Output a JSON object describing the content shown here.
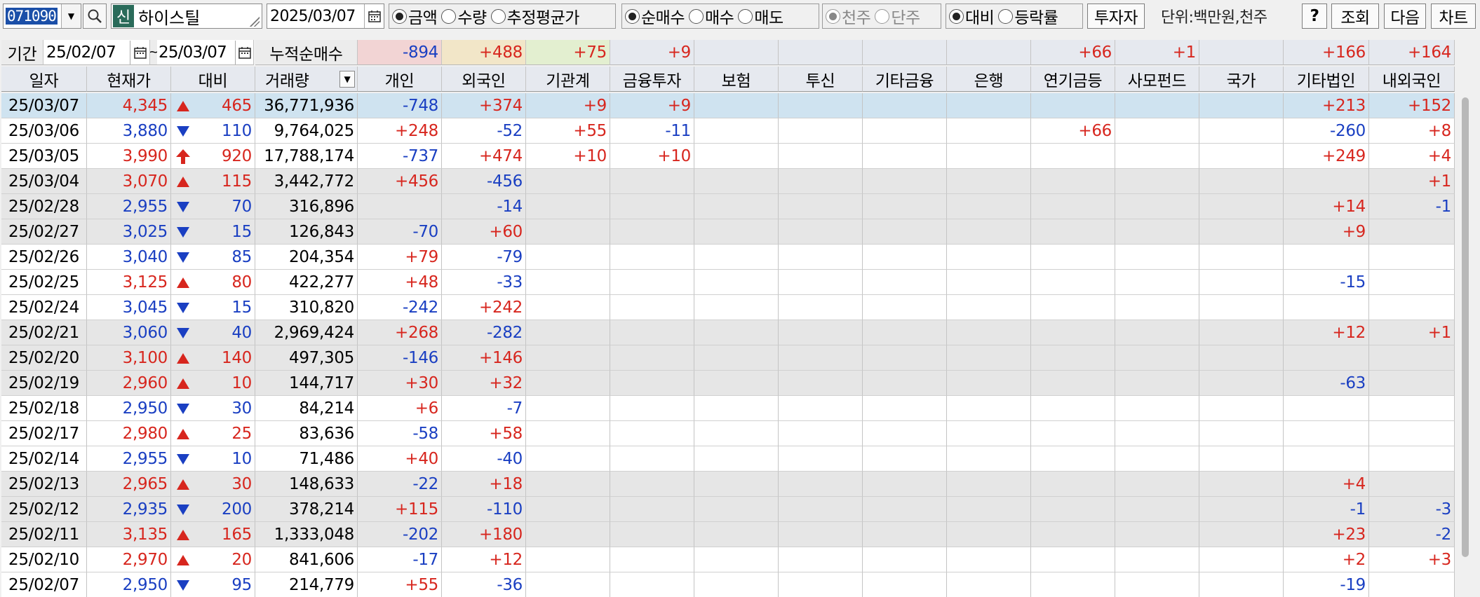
{
  "toolbar": {
    "code": "071090",
    "shin_badge": "신",
    "stock_name": "하이스틸",
    "date": "2025/03/07",
    "radio_amount": [
      {
        "label": "금액",
        "selected": true
      },
      {
        "label": "수량",
        "selected": false
      },
      {
        "label": "추정평균가",
        "selected": false
      }
    ],
    "radio_trade": [
      {
        "label": "순매수",
        "selected": true
      },
      {
        "label": "매수",
        "selected": false
      },
      {
        "label": "매도",
        "selected": false
      }
    ],
    "radio_share": [
      {
        "label": "천주",
        "selected": true
      },
      {
        "label": "단주",
        "selected": false
      }
    ],
    "radio_rate": [
      {
        "label": "대비",
        "selected": true
      },
      {
        "label": "등락률",
        "selected": false
      }
    ],
    "investor_button": "투자자",
    "unit_label": "단위:백만원,천주",
    "help_button": "?",
    "query_button": "조회",
    "next_button": "다음",
    "chart_button": "차트"
  },
  "period": {
    "label": "기간",
    "from": "25/02/07",
    "tilde": "~",
    "to": "25/03/07",
    "cumulative_label": "누적순매수"
  },
  "summary": [
    "-894",
    "+488",
    "+75",
    "+9",
    "",
    "",
    "",
    "",
    "+66",
    "+1",
    "",
    "+166",
    "+164"
  ],
  "headers": [
    "일자",
    "현재가",
    "대비",
    "거래량",
    "개인",
    "외국인",
    "기관계",
    "금융투자",
    "보험",
    "투신",
    "기타금융",
    "은행",
    "연기금등",
    "사모펀드",
    "국가",
    "기타법인",
    "내외국인"
  ],
  "rows": [
    {
      "date": "25/03/07",
      "price": "4,345",
      "dir": "up",
      "chg": "465",
      "vol": "36,771,936",
      "inv": [
        "-748",
        "+374",
        "+9",
        "+9",
        "",
        "",
        "",
        "",
        "",
        "",
        "",
        "+213",
        "+152"
      ]
    },
    {
      "date": "25/03/06",
      "price": "3,880",
      "dir": "down",
      "chg": "110",
      "vol": "9,764,025",
      "inv": [
        "+248",
        "-52",
        "+55",
        "-11",
        "",
        "",
        "",
        "",
        "+66",
        "",
        "",
        "-260",
        "+8"
      ]
    },
    {
      "date": "25/03/05",
      "price": "3,990",
      "dir": "upper",
      "chg": "920",
      "vol": "17,788,174",
      "inv": [
        "-737",
        "+474",
        "+10",
        "+10",
        "",
        "",
        "",
        "",
        "",
        "",
        "",
        "+249",
        "+4"
      ]
    },
    {
      "date": "25/03/04",
      "price": "3,070",
      "dir": "up",
      "chg": "115",
      "vol": "3,442,772",
      "inv": [
        "+456",
        "-456",
        "",
        "",
        "",
        "",
        "",
        "",
        "",
        "",
        "",
        "",
        "+1"
      ]
    },
    {
      "date": "25/02/28",
      "price": "2,955",
      "dir": "down",
      "chg": "70",
      "vol": "316,896",
      "inv": [
        "",
        "-14",
        "",
        "",
        "",
        "",
        "",
        "",
        "",
        "",
        "",
        "+14",
        "-1"
      ]
    },
    {
      "date": "25/02/27",
      "price": "3,025",
      "dir": "down",
      "chg": "15",
      "vol": "126,843",
      "inv": [
        "-70",
        "+60",
        "",
        "",
        "",
        "",
        "",
        "",
        "",
        "",
        "",
        "+9",
        ""
      ]
    },
    {
      "date": "25/02/26",
      "price": "3,040",
      "dir": "down",
      "chg": "85",
      "vol": "204,354",
      "inv": [
        "+79",
        "-79",
        "",
        "",
        "",
        "",
        "",
        "",
        "",
        "",
        "",
        "",
        ""
      ]
    },
    {
      "date": "25/02/25",
      "price": "3,125",
      "dir": "up",
      "chg": "80",
      "vol": "422,277",
      "inv": [
        "+48",
        "-33",
        "",
        "",
        "",
        "",
        "",
        "",
        "",
        "",
        "",
        "-15",
        ""
      ]
    },
    {
      "date": "25/02/24",
      "price": "3,045",
      "dir": "down",
      "chg": "15",
      "vol": "310,820",
      "inv": [
        "-242",
        "+242",
        "",
        "",
        "",
        "",
        "",
        "",
        "",
        "",
        "",
        "",
        ""
      ]
    },
    {
      "date": "25/02/21",
      "price": "3,060",
      "dir": "down",
      "chg": "40",
      "vol": "2,969,424",
      "inv": [
        "+268",
        "-282",
        "",
        "",
        "",
        "",
        "",
        "",
        "",
        "",
        "",
        "+12",
        "+1"
      ]
    },
    {
      "date": "25/02/20",
      "price": "3,100",
      "dir": "up",
      "chg": "140",
      "vol": "497,305",
      "inv": [
        "-146",
        "+146",
        "",
        "",
        "",
        "",
        "",
        "",
        "",
        "",
        "",
        "",
        ""
      ]
    },
    {
      "date": "25/02/19",
      "price": "2,960",
      "dir": "up",
      "chg": "10",
      "vol": "144,717",
      "inv": [
        "+30",
        "+32",
        "",
        "",
        "",
        "",
        "",
        "",
        "",
        "",
        "",
        "-63",
        ""
      ]
    },
    {
      "date": "25/02/18",
      "price": "2,950",
      "dir": "down",
      "chg": "30",
      "vol": "84,214",
      "inv": [
        "+6",
        "-7",
        "",
        "",
        "",
        "",
        "",
        "",
        "",
        "",
        "",
        "",
        ""
      ]
    },
    {
      "date": "25/02/17",
      "price": "2,980",
      "dir": "up",
      "chg": "25",
      "vol": "83,636",
      "inv": [
        "-58",
        "+58",
        "",
        "",
        "",
        "",
        "",
        "",
        "",
        "",
        "",
        "",
        ""
      ]
    },
    {
      "date": "25/02/14",
      "price": "2,955",
      "dir": "down",
      "chg": "10",
      "vol": "71,486",
      "inv": [
        "+40",
        "-40",
        "",
        "",
        "",
        "",
        "",
        "",
        "",
        "",
        "",
        "",
        ""
      ]
    },
    {
      "date": "25/02/13",
      "price": "2,965",
      "dir": "up",
      "chg": "30",
      "vol": "148,633",
      "inv": [
        "-22",
        "+18",
        "",
        "",
        "",
        "",
        "",
        "",
        "",
        "",
        "",
        "+4",
        ""
      ]
    },
    {
      "date": "25/02/12",
      "price": "2,935",
      "dir": "down",
      "chg": "200",
      "vol": "378,214",
      "inv": [
        "+115",
        "-110",
        "",
        "",
        "",
        "",
        "",
        "",
        "",
        "",
        "",
        "-1",
        "-3"
      ]
    },
    {
      "date": "25/02/11",
      "price": "3,135",
      "dir": "up",
      "chg": "165",
      "vol": "1,333,048",
      "inv": [
        "-202",
        "+180",
        "",
        "",
        "",
        "",
        "",
        "",
        "",
        "",
        "",
        "+23",
        "-2"
      ]
    },
    {
      "date": "25/02/10",
      "price": "2,970",
      "dir": "up",
      "chg": "20",
      "vol": "841,606",
      "inv": [
        "-17",
        "+12",
        "",
        "",
        "",
        "",
        "",
        "",
        "",
        "",
        "",
        "+2",
        "+3"
      ]
    },
    {
      "date": "25/02/07",
      "price": "2,950",
      "dir": "down",
      "chg": "95",
      "vol": "214,779",
      "inv": [
        "+55",
        "-36",
        "",
        "",
        "",
        "",
        "",
        "",
        "",
        "",
        "",
        "-19",
        ""
      ]
    }
  ],
  "row_shading": [
    "sel",
    "w",
    "w",
    "g",
    "g",
    "g",
    "w",
    "w",
    "w",
    "g",
    "g",
    "g",
    "w",
    "w",
    "w",
    "g",
    "g",
    "g",
    "w",
    "w"
  ],
  "colors": {
    "up": "#d7261e",
    "down": "#1a3fc2",
    "selected_row": "#cfe3f0",
    "gray_row": "#e6e6e6",
    "header_bg": "#e6e9ef",
    "summary_individual_bg": "#f2d4d4",
    "summary_foreign_bg": "#f2e6c8",
    "summary_inst_bg": "#e3efd0"
  },
  "icons": {
    "search": "magnifier-icon",
    "calendar": "calendar-icon",
    "dropdown": "chevron-down-icon",
    "up": "triangle-up-icon",
    "down": "triangle-down-icon",
    "upper_limit": "arrow-up-icon"
  }
}
